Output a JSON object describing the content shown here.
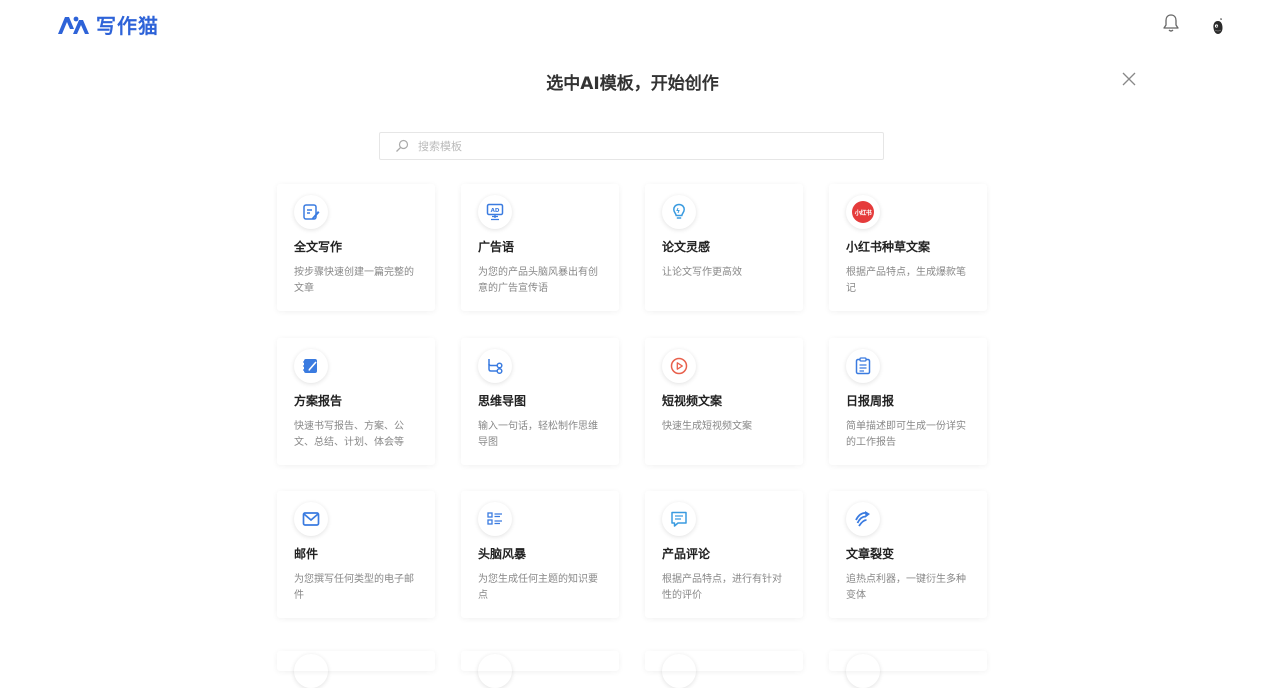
{
  "brand": {
    "name": "写作猫",
    "color": "#2e63d8"
  },
  "header": {
    "bell_icon": "bell-icon",
    "avatar_icon": "avatar-icon"
  },
  "modal": {
    "title": "选中AI模板，开始创作",
    "close_icon": "close-icon"
  },
  "search": {
    "placeholder": "搜索模板",
    "value": ""
  },
  "templates": [
    {
      "title": "全文写作",
      "desc": "按步骤快速创建一篇完整的文章",
      "icon": "edit-doc-icon"
    },
    {
      "title": "广告语",
      "desc": "为您的产品头脑风暴出有创意的广告宣传语",
      "icon": "ad-board-icon"
    },
    {
      "title": "论文灵感",
      "desc": "让论文写作更高效",
      "icon": "lightbulb-icon"
    },
    {
      "title": "小红书种草文案",
      "desc": "根据产品特点，生成爆款笔记",
      "icon": "xiaohongshu-icon",
      "icon_text": "小红书"
    },
    {
      "title": "方案报告",
      "desc": "快速书写报告、方案、公文、总结、计划、体会等",
      "icon": "notebook-pen-icon"
    },
    {
      "title": "思维导图",
      "desc": "输入一句话，轻松制作思维导图",
      "icon": "mindmap-icon"
    },
    {
      "title": "短视频文案",
      "desc": "快速生成短视频文案",
      "icon": "play-circle-icon"
    },
    {
      "title": "日报周报",
      "desc": "简单描述即可生成一份详实的工作报告",
      "icon": "clipboard-icon"
    },
    {
      "title": "邮件",
      "desc": "为您撰写任何类型的电子邮件",
      "icon": "mail-icon"
    },
    {
      "title": "头脑风暴",
      "desc": "为您生成任何主题的知识要点",
      "icon": "list-icon"
    },
    {
      "title": "产品评论",
      "desc": "根据产品特点，进行有针对性的评价",
      "icon": "comment-icon"
    },
    {
      "title": "文章裂变",
      "desc": "追热点利器，一键衍生多种变体",
      "icon": "swirl-arrow-icon"
    }
  ]
}
